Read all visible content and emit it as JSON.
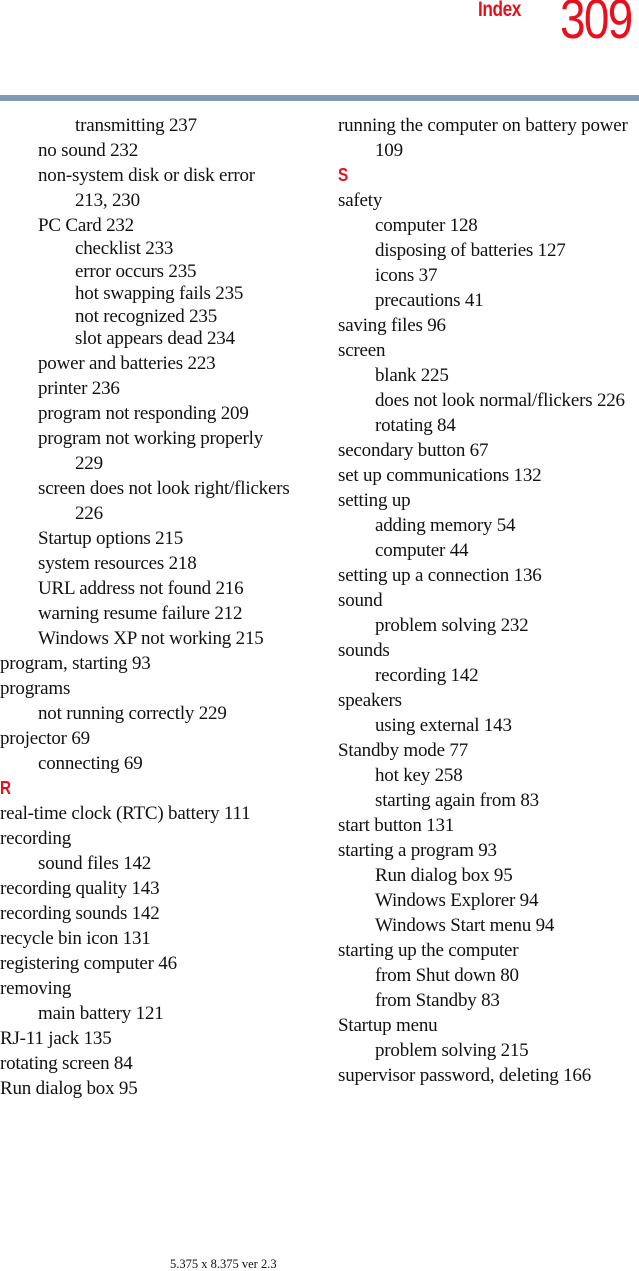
{
  "header": {
    "section_label": "Index",
    "page_number": "309"
  },
  "colors": {
    "accent": "#e8101c",
    "rule": "#7f9ab2"
  },
  "columns": {
    "left": [
      {
        "text": "transmitting 237",
        "level": 2
      },
      {
        "text": "no sound 232",
        "level": 1
      },
      {
        "text": "non-system disk or disk error",
        "level": 1
      },
      {
        "text": "213, 230",
        "level": 2
      },
      {
        "text": "PC Card 232",
        "level": 1
      },
      {
        "text": "checklist 233",
        "level": 2,
        "tight": true
      },
      {
        "text": "error occurs 235",
        "level": 2,
        "tight": true
      },
      {
        "text": "hot swapping fails 235",
        "level": 2,
        "tight": true
      },
      {
        "text": "not recognized 235",
        "level": 2,
        "tight": true
      },
      {
        "text": "slot appears dead 234",
        "level": 2,
        "tight": true
      },
      {
        "text": "power and batteries 223",
        "level": 1
      },
      {
        "text": "printer 236",
        "level": 1
      },
      {
        "text": "program not responding 209",
        "level": 1
      },
      {
        "text": "program not working properly",
        "level": 1
      },
      {
        "text": "229",
        "level": 2
      },
      {
        "text": "screen does not look right/flickers",
        "level": 1
      },
      {
        "text": "226",
        "level": 2
      },
      {
        "text": "Startup options 215",
        "level": 1
      },
      {
        "text": "system resources 218",
        "level": 1
      },
      {
        "text": "URL address not found 216",
        "level": 1
      },
      {
        "text": "warning resume failure 212",
        "level": 1
      },
      {
        "text": "Windows XP not working 215",
        "level": 1
      },
      {
        "text": "program, starting 93",
        "level": 0
      },
      {
        "text": "programs",
        "level": 0
      },
      {
        "text": "not running correctly 229",
        "level": 1
      },
      {
        "text": "projector 69",
        "level": 0
      },
      {
        "text": "connecting 69",
        "level": 1
      },
      {
        "text": "R",
        "letter": true
      },
      {
        "text": "real-time clock (RTC) battery 111",
        "level": 0
      },
      {
        "text": "recording",
        "level": 0
      },
      {
        "text": "sound files 142",
        "level": 1
      },
      {
        "text": "recording quality 143",
        "level": 0
      },
      {
        "text": "recording sounds 142",
        "level": 0
      },
      {
        "text": "recycle bin icon 131",
        "level": 0
      },
      {
        "text": "registering computer 46",
        "level": 0
      },
      {
        "text": "removing",
        "level": 0
      },
      {
        "text": "main battery 121",
        "level": 1
      },
      {
        "text": "RJ-11 jack 135",
        "level": 0
      },
      {
        "text": "rotating screen 84",
        "level": 0
      },
      {
        "text": "Run dialog box 95",
        "level": 0
      }
    ],
    "right": [
      {
        "text": "running the computer on battery power",
        "level": 0
      },
      {
        "text": "109",
        "level": 1
      },
      {
        "text": "S",
        "letter": true
      },
      {
        "text": "safety",
        "level": 0
      },
      {
        "text": "computer 128",
        "level": 1
      },
      {
        "text": "disposing of batteries 127",
        "level": 1
      },
      {
        "text": "icons 37",
        "level": 1
      },
      {
        "text": "precautions 41",
        "level": 1
      },
      {
        "text": "saving files 96",
        "level": 0
      },
      {
        "text": "screen",
        "level": 0
      },
      {
        "text": "blank 225",
        "level": 1
      },
      {
        "text": "does not look normal/flickers 226",
        "level": 1
      },
      {
        "text": "rotating 84",
        "level": 1
      },
      {
        "text": "secondary button 67",
        "level": 0
      },
      {
        "text": "set up communications 132",
        "level": 0
      },
      {
        "text": "setting up",
        "level": 0
      },
      {
        "text": "adding memory 54",
        "level": 1
      },
      {
        "text": "computer 44",
        "level": 1
      },
      {
        "text": "setting up a connection 136",
        "level": 0
      },
      {
        "text": "sound",
        "level": 0
      },
      {
        "text": "problem solving 232",
        "level": 1
      },
      {
        "text": "sounds",
        "level": 0
      },
      {
        "text": "recording 142",
        "level": 1
      },
      {
        "text": "speakers",
        "level": 0
      },
      {
        "text": "using external 143",
        "level": 1
      },
      {
        "text": "Standby mode 77",
        "level": 0
      },
      {
        "text": "hot key 258",
        "level": 1
      },
      {
        "text": "starting again from 83",
        "level": 1
      },
      {
        "text": "start button 131",
        "level": 0
      },
      {
        "text": "starting a program 93",
        "level": 0
      },
      {
        "text": "Run dialog box 95",
        "level": 1
      },
      {
        "text": "Windows Explorer 94",
        "level": 1
      },
      {
        "text": "Windows Start menu 94",
        "level": 1
      },
      {
        "text": "starting up the computer",
        "level": 0
      },
      {
        "text": "from Shut down 80",
        "level": 1
      },
      {
        "text": "from Standby 83",
        "level": 1
      },
      {
        "text": "Startup menu",
        "level": 0
      },
      {
        "text": "problem solving 215",
        "level": 1
      },
      {
        "text": "supervisor password, deleting 166",
        "level": 0
      }
    ]
  },
  "footer": {
    "text": "5.375 x 8.375 ver 2.3"
  }
}
